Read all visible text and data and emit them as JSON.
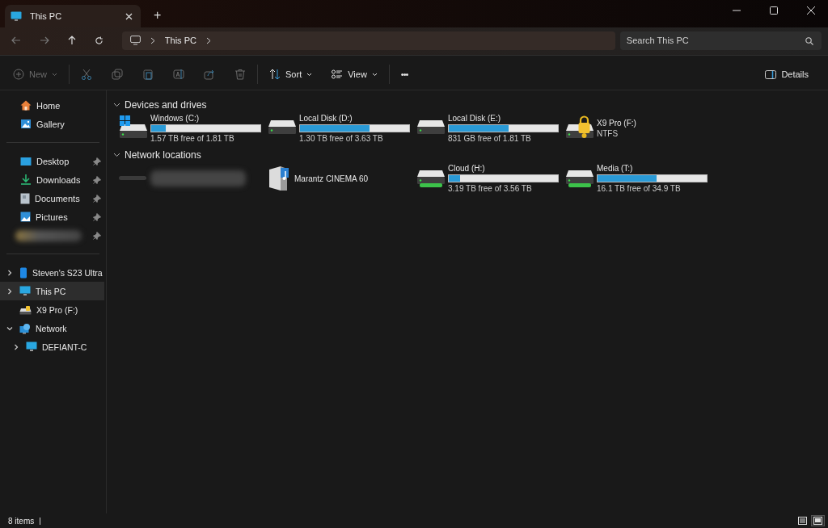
{
  "window": {
    "tab_title": "This PC",
    "new_tab": "+"
  },
  "address": {
    "crumbs": [
      "This PC"
    ],
    "search_placeholder": "Search This PC"
  },
  "toolbar": {
    "items": [
      {
        "kind": "new",
        "label": "New",
        "disabled": true
      },
      {
        "kind": "cut",
        "disabled": true
      },
      {
        "kind": "copy",
        "disabled": true
      },
      {
        "kind": "paste",
        "disabled": true
      },
      {
        "kind": "rename",
        "disabled": true
      },
      {
        "kind": "share",
        "disabled": true
      },
      {
        "kind": "delete",
        "disabled": true
      },
      {
        "kind": "sort",
        "label": "Sort",
        "disabled": false
      },
      {
        "kind": "view",
        "label": "View",
        "disabled": false
      },
      {
        "kind": "more",
        "label": "•••",
        "disabled": false
      }
    ],
    "details": "Details"
  },
  "sidebar": {
    "top": [
      {
        "kind": "home",
        "label": "Home"
      },
      {
        "kind": "gallery",
        "label": "Gallery"
      }
    ],
    "pinned": [
      {
        "kind": "desktop",
        "label": "Desktop"
      },
      {
        "kind": "downloads",
        "label": "Downloads"
      },
      {
        "kind": "documents",
        "label": "Documents"
      },
      {
        "kind": "pictures",
        "label": "Pictures"
      },
      {
        "kind": "redacted"
      }
    ],
    "tree": [
      {
        "kind": "phone",
        "label": "Steven's S23 Ultra",
        "expandable": true,
        "expanded": false,
        "selected": false
      },
      {
        "kind": "pc",
        "label": "This PC",
        "expandable": true,
        "expanded": false,
        "selected": true
      },
      {
        "kind": "locked-drive",
        "label": "X9 Pro (F:)",
        "expandable": false,
        "selected": false
      },
      {
        "kind": "network",
        "label": "Network",
        "expandable": true,
        "expanded": true,
        "selected": false,
        "children": [
          {
            "kind": "pc",
            "label": "DEFIANT-C",
            "expandable": true,
            "expanded": false,
            "selected": false
          }
        ]
      }
    ]
  },
  "sections": [
    {
      "title": "Devices and drives",
      "expanded": true,
      "items": [
        {
          "kind": "windows-drive",
          "name": "Windows (C:)",
          "level": 0.13,
          "detail": "1.57 TB free of 1.81 TB"
        },
        {
          "kind": "drive",
          "name": "Local Disk (D:)",
          "level": 0.64,
          "detail": "1.30 TB free of 3.63 TB"
        },
        {
          "kind": "drive",
          "name": "Local Disk (E:)",
          "level": 0.55,
          "detail": "831 GB free of 1.81 TB"
        },
        {
          "kind": "locked-drive",
          "name": "X9 Pro (F:)",
          "detail": "NTFS"
        }
      ]
    },
    {
      "title": "Network locations",
      "expanded": true,
      "items": [
        {
          "kind": "redacted"
        },
        {
          "kind": "media-device",
          "name": "Marantz CINEMA 60"
        },
        {
          "kind": "network-drive",
          "name": "Cloud (H:)",
          "level": 0.1,
          "detail": "3.19 TB free of 3.56 TB"
        },
        {
          "kind": "network-drive",
          "name": "Media (T:)",
          "level": 0.54,
          "detail": "16.1 TB free of 34.9 TB"
        }
      ]
    }
  ],
  "status_bar": {
    "count": "8 items",
    "views": [
      {
        "kind": "details",
        "selected": false
      },
      {
        "kind": "tiles",
        "selected": true
      }
    ]
  }
}
